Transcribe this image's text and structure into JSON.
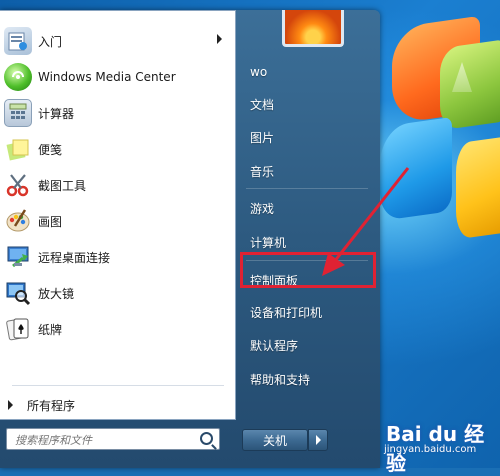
{
  "theme": {
    "accent_red": "#e02233",
    "right_pane_text": "#ffffff"
  },
  "start_menu": {
    "programs": [
      {
        "label": "入门",
        "icon": "getting-started-icon",
        "has_submenu": true
      },
      {
        "label": "Windows Media Center",
        "icon": "media-center-icon",
        "has_submenu": false
      },
      {
        "label": "计算器",
        "icon": "calculator-icon",
        "has_submenu": false
      },
      {
        "label": "便笺",
        "icon": "sticky-notes-icon",
        "has_submenu": false
      },
      {
        "label": "截图工具",
        "icon": "snipping-tool-icon",
        "has_submenu": false
      },
      {
        "label": "画图",
        "icon": "paint-icon",
        "has_submenu": false
      },
      {
        "label": "远程桌面连接",
        "icon": "remote-desktop-icon",
        "has_submenu": false
      },
      {
        "label": "放大镜",
        "icon": "magnifier-icon",
        "has_submenu": false
      },
      {
        "label": "纸牌",
        "icon": "solitaire-icon",
        "has_submenu": false
      }
    ],
    "all_programs_label": "所有程序",
    "search_placeholder": "搜索程序和文件",
    "right_items": [
      {
        "label": "wo"
      },
      {
        "label": "文档"
      },
      {
        "label": "图片"
      },
      {
        "label": "音乐"
      },
      {
        "label": "游戏"
      },
      {
        "label": "计算机"
      },
      {
        "label": "控制面板",
        "highlighted": true
      },
      {
        "label": "设备和打印机"
      },
      {
        "label": "默认程序"
      },
      {
        "label": "帮助和支持"
      }
    ],
    "shutdown_label": "关机"
  },
  "watermark": {
    "logo_text": "Bai du 经验",
    "url": "jingyan.baidu.com"
  }
}
